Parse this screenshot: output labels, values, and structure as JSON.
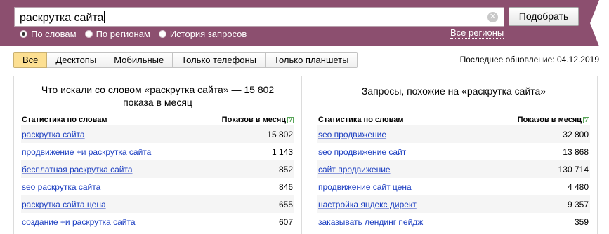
{
  "colors": {
    "header_bg": "#8c4f6f",
    "tab_active": "#fcdf92",
    "link": "#1a3dc1"
  },
  "search": {
    "value": "раскрутка сайта",
    "button": "Подобрать"
  },
  "modes": [
    {
      "label": "По словам",
      "checked": true
    },
    {
      "label": "По регионам",
      "checked": false
    },
    {
      "label": "История запросов",
      "checked": false
    }
  ],
  "all_regions": "Все регионы",
  "tabs": [
    "Все",
    "Десктопы",
    "Мобильные",
    "Только телефоны",
    "Только планшеты"
  ],
  "last_update": "Последнее обновление: 04.12.2019",
  "left_panel": {
    "title": "Что искали со словом «раскрутка сайта» — 15 802 показа в месяц",
    "col_words": "Статистика по словам",
    "col_shows": "Показов в месяц",
    "rows": [
      {
        "kw": "раскрутка сайта",
        "count": "15 802"
      },
      {
        "kw": "продвижение +и раскрутка сайта",
        "count": "1 143"
      },
      {
        "kw": "бесплатная раскрутка сайта",
        "count": "852"
      },
      {
        "kw": "seo раскрутка сайта",
        "count": "846"
      },
      {
        "kw": "раскрутка сайта цена",
        "count": "655"
      },
      {
        "kw": "создание +и раскрутка сайта",
        "count": "607"
      }
    ]
  },
  "right_panel": {
    "title": "Запросы, похожие на «раскрутка сайта»",
    "col_words": "Статистика по словам",
    "col_shows": "Показов в месяц",
    "rows": [
      {
        "kw": "seo продвижение",
        "count": "32 800"
      },
      {
        "kw": "seo продвижение сайт",
        "count": "13 868"
      },
      {
        "kw": "сайт продвижение",
        "count": "130 714"
      },
      {
        "kw": "продвижение сайт цена",
        "count": "4 480"
      },
      {
        "kw": "настройка яндекс директ",
        "count": "9 357"
      },
      {
        "kw": "заказывать лендинг пейдж",
        "count": "359"
      }
    ]
  }
}
